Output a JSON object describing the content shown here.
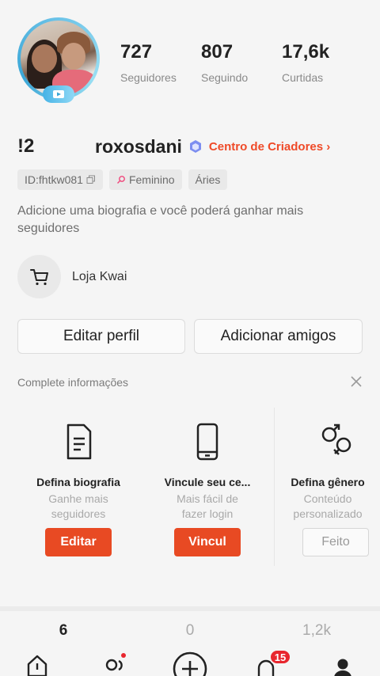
{
  "stats": [
    {
      "value": "727",
      "label": "Seguidores"
    },
    {
      "value": "807",
      "label": "Seguindo"
    },
    {
      "value": "17,6k",
      "label": "Curtidas"
    }
  ],
  "profile": {
    "name_prefix": "!2",
    "username": "roxosdani",
    "creator_link": "Centro de Criadores ›",
    "tags": {
      "id": "ID:fhtkw081",
      "gender": "Feminino",
      "sign": "Áries"
    },
    "bio": "Adicione uma biografia e você poderá ganhar mais seguidores",
    "shop_label": "Loja Kwai"
  },
  "buttons": {
    "edit_profile": "Editar perfil",
    "add_friends": "Adicionar amigos"
  },
  "complete": {
    "title": "Complete informações",
    "cards": [
      {
        "title": "Defina biografia",
        "sub": "Ganhe mais seguidores",
        "action": "Editar"
      },
      {
        "title": "Vincule seu ce...",
        "sub": "Mais fácil de fazer  login",
        "action": "Vincul"
      },
      {
        "title": "Defina gênero",
        "sub": "Conteúdo personalizado",
        "action": "Feito"
      }
    ]
  },
  "counts": [
    "6",
    "0",
    "1,2k"
  ],
  "nav": {
    "notification_badge": "15"
  },
  "colors": {
    "accent": "#ef4a28",
    "button_red": "#e84a23",
    "badge_red": "#e8262e"
  }
}
